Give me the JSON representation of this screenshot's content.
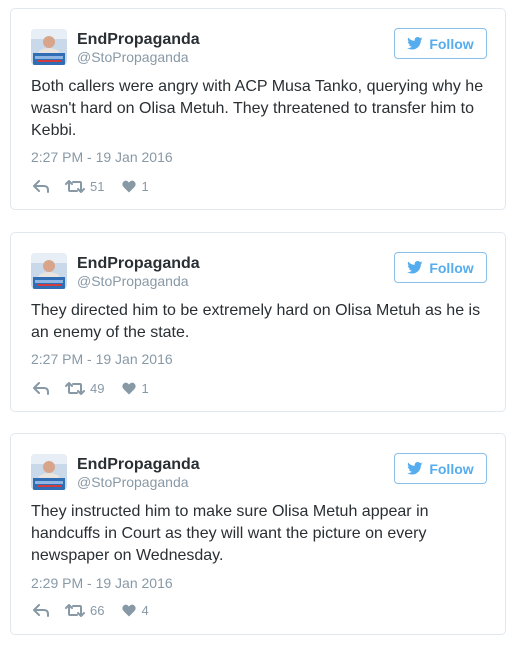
{
  "colors": {
    "accent": "#55acee",
    "follow_border": "#88c2ec",
    "text": "#292f33",
    "muted": "#8899a6",
    "card_border": "#e1e8ed"
  },
  "icons": {
    "reply": "reply-arrow-icon",
    "retweet": "retweet-icon",
    "like": "heart-icon",
    "follow": "twitter-bird-icon"
  },
  "tweets": [
    {
      "name": "EndPropaganda",
      "handle": "@StoPropaganda",
      "follow_label": "Follow",
      "text": "Both callers were angry with ACP Musa Tanko, querying why he wasn't hard on Olisa Metuh. They threatened to transfer him to Kebbi.",
      "timestamp": "2:27 PM - 19 Jan 2016",
      "retweets": "51",
      "likes": "1"
    },
    {
      "name": "EndPropaganda",
      "handle": "@StoPropaganda",
      "follow_label": "Follow",
      "text": "They directed him to be extremely hard on Olisa Metuh as he is an enemy of the state.",
      "timestamp": "2:27 PM - 19 Jan 2016",
      "retweets": "49",
      "likes": "1"
    },
    {
      "name": "EndPropaganda",
      "handle": "@StoPropaganda",
      "follow_label": "Follow",
      "text": "They instructed him to make sure Olisa Metuh appear in handcuffs in Court as they will want the picture on every newspaper on Wednesday.",
      "timestamp": "2:29 PM - 19 Jan 2016",
      "retweets": "66",
      "likes": "4"
    }
  ]
}
